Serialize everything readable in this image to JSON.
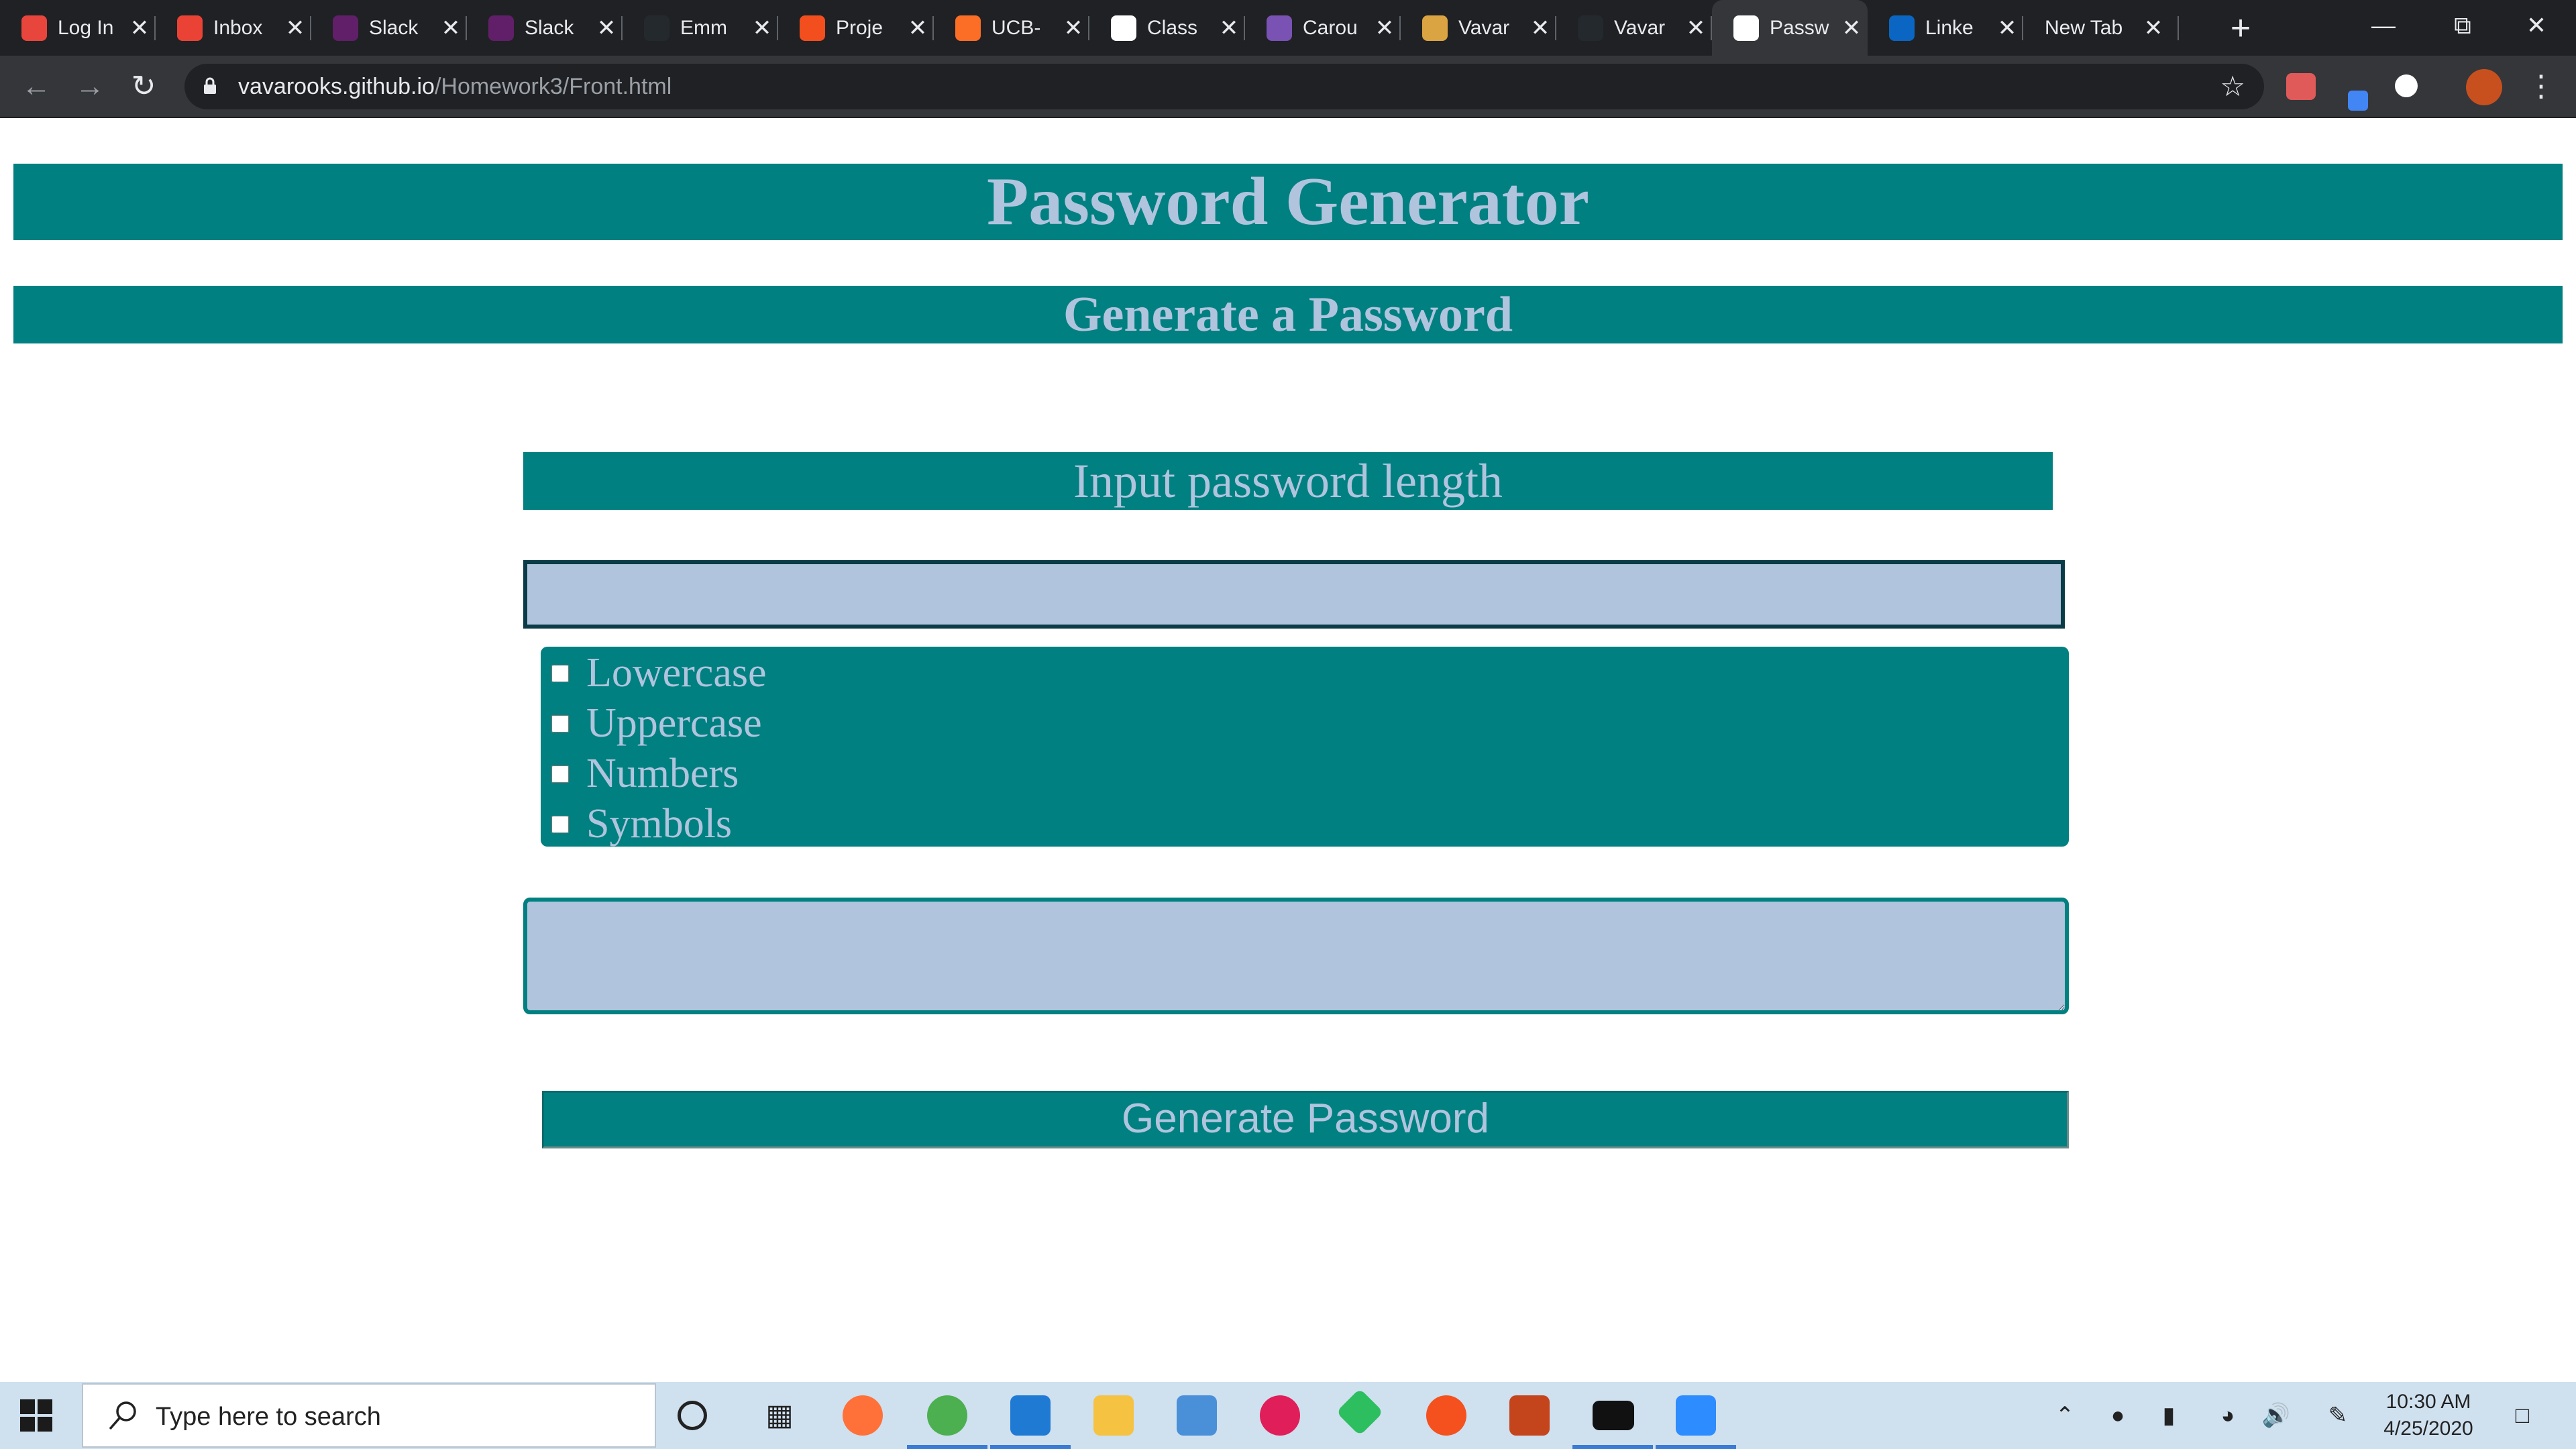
{
  "browser": {
    "tabs": [
      {
        "title": "Log In",
        "icon": "alert-triangle-icon",
        "color": "#e8453c"
      },
      {
        "title": "Inbox",
        "icon": "gmail-icon",
        "color": "#ea4335"
      },
      {
        "title": "Slack",
        "icon": "slack-icon",
        "color": "#611f69"
      },
      {
        "title": "Slack",
        "icon": "slack-icon",
        "color": "#611f69"
      },
      {
        "title": "Emm",
        "icon": "github-icon",
        "color": "#24292e"
      },
      {
        "title": "Proje",
        "icon": "figma-icon",
        "color": "#f24e1e"
      },
      {
        "title": "UCB-",
        "icon": "gitlab-icon",
        "color": "#fc6d26"
      },
      {
        "title": "Class",
        "icon": "globe-icon",
        "color": "#ffffff"
      },
      {
        "title": "Carou",
        "icon": "bootstrap-icon",
        "color": "#7952b3"
      },
      {
        "title": "Vavar",
        "icon": "avatar-icon",
        "color": "#d9a441"
      },
      {
        "title": "Vavar",
        "icon": "github-icon",
        "color": "#24292e"
      },
      {
        "title": "Passw",
        "icon": "globe-icon",
        "color": "#ffffff",
        "active": true
      },
      {
        "title": "Linke",
        "icon": "linkedin-icon",
        "color": "#0a66c2"
      },
      {
        "title": "New Tab",
        "icon": "",
        "color": ""
      }
    ],
    "new_tab_label": "+",
    "url_host": "vavarooks.github.io",
    "url_path": "/Homework3/Front.html"
  },
  "page": {
    "title": "Password Generator",
    "subtitle": "Generate a Password",
    "length_label": "Input password length",
    "length_value": "",
    "options": [
      {
        "label": "Lowercase",
        "checked": false
      },
      {
        "label": "Uppercase",
        "checked": false
      },
      {
        "label": "Numbers",
        "checked": false
      },
      {
        "label": "Symbols",
        "checked": false
      }
    ],
    "result_value": "",
    "generate_label": "Generate Password",
    "colors": {
      "accent": "#008080",
      "text": "#b0c4de",
      "input_bg": "#b0c4de"
    }
  },
  "taskbar": {
    "search_placeholder": "Type here to search",
    "time": "10:30 AM",
    "date": "4/25/2020"
  }
}
